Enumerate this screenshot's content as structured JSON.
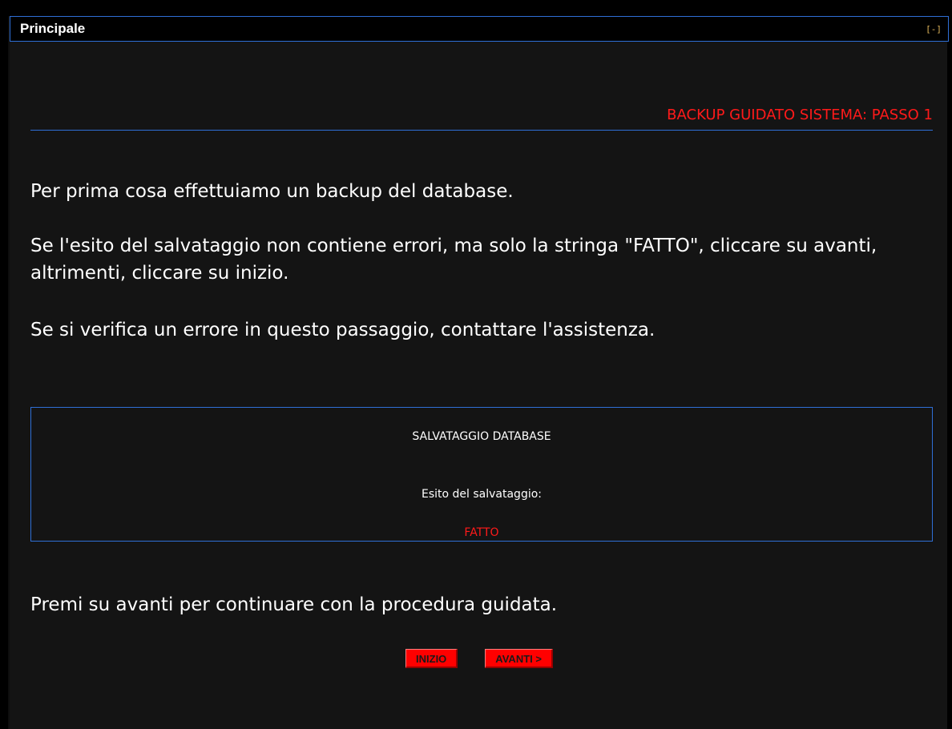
{
  "window": {
    "title": "Principale",
    "collapse_label": "[-]"
  },
  "wizard": {
    "header": "BACKUP GUIDATO SISTEMA: PASSO 1",
    "paragraphs": [
      "Per prima cosa effettuiamo un backup del database.",
      "Se l'esito del salvataggio non contiene errori, ma solo la stringa \"FATTO\", cliccare su avanti, altrimenti, cliccare su inizio.",
      "Se si verifica un errore in questo passaggio, contattare l'assistenza."
    ],
    "result": {
      "title": "SALVATAGGIO DATABASE",
      "label": "Esito del salvataggio:",
      "status": "FATTO"
    },
    "footer": "Premi su avanti per continuare con la procedura guidata.",
    "buttons": {
      "start_label": "INIZIO",
      "next_label": "AVANTI >"
    }
  },
  "colors": {
    "accent_red": "#ff1a1a",
    "border_blue": "#2f6fd6",
    "panel_bg": "#141414",
    "button_bg": "#ff0000"
  }
}
